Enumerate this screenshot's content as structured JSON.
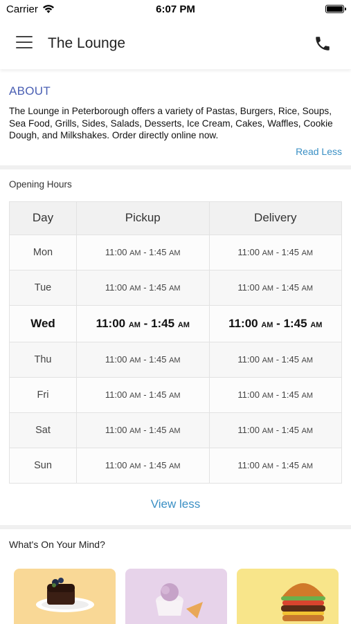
{
  "status": {
    "carrier": "Carrier",
    "time": "6:07 PM"
  },
  "header": {
    "title": "The Lounge"
  },
  "about": {
    "title": "ABOUT",
    "text": "The Lounge in Peterborough offers a variety of Pastas, Burgers, Rice, Soups, Sea Food, Grills, Sides, Salads, Desserts, Ice Cream, Cakes, Waffles, Cookie Dough, and Milkshakes. Order directly online now.",
    "toggle": "Read Less"
  },
  "hours": {
    "title": "Opening Hours",
    "columns": [
      "Day",
      "Pickup",
      "Delivery"
    ],
    "rows": [
      {
        "day": "Mon",
        "pickup_from": "11:00",
        "pickup_from_ampm": "AM",
        "pickup_to": "1:45",
        "pickup_to_ampm": "AM",
        "delivery_from": "11:00",
        "delivery_from_ampm": "AM",
        "delivery_to": "1:45",
        "delivery_to_ampm": "AM"
      },
      {
        "day": "Tue",
        "pickup_from": "11:00",
        "pickup_from_ampm": "AM",
        "pickup_to": "1:45",
        "pickup_to_ampm": "AM",
        "delivery_from": "11:00",
        "delivery_from_ampm": "AM",
        "delivery_to": "1:45",
        "delivery_to_ampm": "AM"
      },
      {
        "day": "Wed",
        "pickup_from": "11:00",
        "pickup_from_ampm": "AM",
        "pickup_to": "1:45",
        "pickup_to_ampm": "AM",
        "delivery_from": "11:00",
        "delivery_from_ampm": "AM",
        "delivery_to": "1:45",
        "delivery_to_ampm": "AM"
      },
      {
        "day": "Thu",
        "pickup_from": "11:00",
        "pickup_from_ampm": "AM",
        "pickup_to": "1:45",
        "pickup_to_ampm": "AM",
        "delivery_from": "11:00",
        "delivery_from_ampm": "AM",
        "delivery_to": "1:45",
        "delivery_to_ampm": "AM"
      },
      {
        "day": "Fri",
        "pickup_from": "11:00",
        "pickup_from_ampm": "AM",
        "pickup_to": "1:45",
        "pickup_to_ampm": "AM",
        "delivery_from": "11:00",
        "delivery_from_ampm": "AM",
        "delivery_to": "1:45",
        "delivery_to_ampm": "AM"
      },
      {
        "day": "Sat",
        "pickup_from": "11:00",
        "pickup_from_ampm": "AM",
        "pickup_to": "1:45",
        "pickup_to_ampm": "AM",
        "delivery_from": "11:00",
        "delivery_from_ampm": "AM",
        "delivery_to": "1:45",
        "delivery_to_ampm": "AM"
      },
      {
        "day": "Sun",
        "pickup_from": "11:00",
        "pickup_from_ampm": "AM",
        "pickup_to": "1:45",
        "pickup_to_ampm": "AM",
        "delivery_from": "11:00",
        "delivery_from_ampm": "AM",
        "delivery_to": "1:45",
        "delivery_to_ampm": "AM"
      }
    ],
    "toggle": "View less"
  },
  "mind": {
    "title": "What's On Your Mind?",
    "cards": [
      {
        "icon": "chocolate-cake-icon",
        "color": "#f9d896"
      },
      {
        "icon": "ice-cream-icon",
        "color": "#e7d3ea"
      },
      {
        "icon": "burger-icon",
        "color": "#f8e58a"
      }
    ]
  },
  "colors": {
    "accent": "#4a5fb3",
    "link": "#3a8fc4"
  }
}
